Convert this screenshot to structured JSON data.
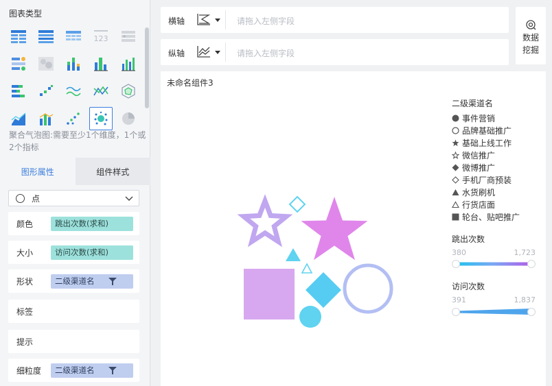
{
  "left_panel": {
    "chart_type_title": "图表类型",
    "description": "聚合气泡图:需要至少1个维度，1个或2个指标",
    "tabs": [
      {
        "label": "图形属性",
        "active": true
      },
      {
        "label": "组件样式",
        "active": false
      }
    ],
    "mark_type": "点",
    "properties": [
      {
        "label": "颜色",
        "field": "跳出次数(求和)",
        "pill": "teal"
      },
      {
        "label": "大小",
        "field": "访问次数(求和)",
        "pill": "teal"
      },
      {
        "label": "形状",
        "field": "二级渠道名",
        "pill": "blue"
      },
      {
        "label": "标签",
        "field": ""
      },
      {
        "label": "提示",
        "field": ""
      },
      {
        "label": "细粒度",
        "field": "二级渠道名",
        "pill": "blue"
      }
    ]
  },
  "axes": {
    "x": {
      "label": "横轴",
      "placeholder": "请拖入左侧字段",
      "icon": "area-chart-icon"
    },
    "y": {
      "label": "纵轴",
      "placeholder": "请拖入左侧字段",
      "icon": "line-chart-icon"
    }
  },
  "mining_button": {
    "line1": "数据",
    "line2": "挖掘"
  },
  "canvas": {
    "title": "未命名组件3",
    "legend": {
      "title": "二级渠道名",
      "items": [
        {
          "label": "事件营销",
          "shape": "circle-filled"
        },
        {
          "label": "品牌基础推广",
          "shape": "circle-outline"
        },
        {
          "label": "基础上线工作",
          "shape": "star-filled"
        },
        {
          "label": "微信推广",
          "shape": "star-outline"
        },
        {
          "label": "微博推广",
          "shape": "diamond-filled"
        },
        {
          "label": "手机厂商预装",
          "shape": "diamond-outline"
        },
        {
          "label": "水货刷机",
          "shape": "triangle-filled"
        },
        {
          "label": "行货店面",
          "shape": "triangle-outline"
        },
        {
          "label": "轮台、贴吧推广",
          "shape": "square-filled"
        }
      ]
    },
    "color_legend": {
      "title": "跳出次数",
      "min": "380",
      "max": "1,723"
    },
    "size_legend": {
      "title": "访问次数",
      "min": "391",
      "max": "1,837"
    }
  },
  "colors": {
    "accent": "#3b7ddd",
    "teal_pill": "#9de1dc",
    "blue_pill": "#bfcdef",
    "bubble_purple": "#d7a8f0",
    "bubble_violet": "#c0a7f0",
    "bubble_lightpurple": "#c7b1ee",
    "bubble_magenta": "#e086eb",
    "bubble_cyan": "#5fd3f0",
    "bubble_skyblue": "#56ccf2",
    "bubble_periwinkle": "#b3bff3"
  }
}
